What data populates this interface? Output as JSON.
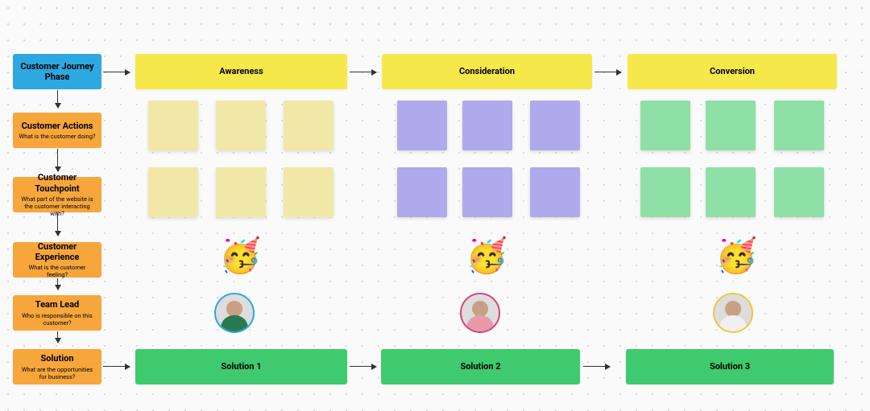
{
  "header": {
    "main": {
      "title": "Customer Journey Phase"
    },
    "phases": [
      "Awareness",
      "Consideration",
      "Conversion"
    ]
  },
  "rows": {
    "actions": {
      "title": "Customer Actions",
      "sub": "What is the customer doing?"
    },
    "touchpoint": {
      "title": "Customer Touchpoint",
      "sub": "What part of the website is the customer interacting with?"
    },
    "experience": {
      "title": "Customer Experience",
      "sub": "What is the customer feeling?"
    },
    "teamlead": {
      "title": "Team Lead",
      "sub": "Who is responsible on this customer?"
    },
    "solution": {
      "title": "Solution",
      "sub": "What are the opportunities for business?"
    }
  },
  "solutions": [
    "Solution 1",
    "Solution 2",
    "Solution 3"
  ],
  "emoji": {
    "party": "🥳"
  },
  "colors": {
    "avatarBorders": [
      "#2da8e0",
      "#e0407a",
      "#f2c63c"
    ],
    "avatarBodies": [
      "#2a7a4f",
      "#e79aa8",
      "#f0f0f0"
    ]
  }
}
